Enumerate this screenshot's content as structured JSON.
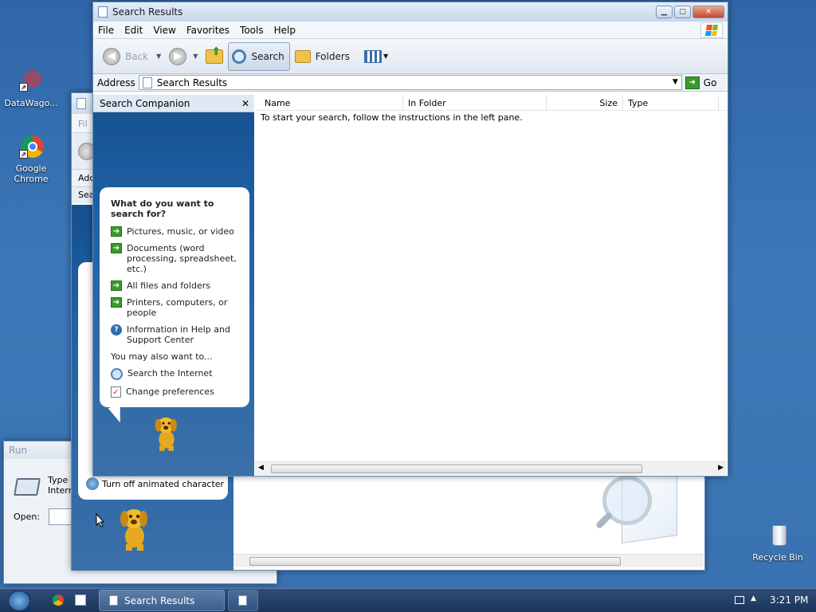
{
  "desktop": {
    "icons": [
      {
        "label": "DataWago..."
      },
      {
        "label": "Google Chrome"
      },
      {
        "label": "Recycle Bin"
      }
    ]
  },
  "run_dialog": {
    "title": "Run",
    "text": "Type\nIntern",
    "open_label": "Open:"
  },
  "back_window": {
    "menu_fragment": "Fil",
    "address_fragment": "Add",
    "search_fragment": "Sea",
    "turn_off_label": "Turn off animated character"
  },
  "main_window": {
    "title": "Search Results",
    "menu": [
      "File",
      "Edit",
      "View",
      "Favorites",
      "Tools",
      "Help"
    ],
    "toolbar": {
      "back_label": "Back",
      "search_label": "Search",
      "folders_label": "Folders"
    },
    "address": {
      "label": "Address",
      "value": "Search Results",
      "go_label": "Go"
    },
    "companion": {
      "title": "Search Companion",
      "question": "What do you want to search for?",
      "options": [
        {
          "label": "Pictures, music, or video",
          "icon": "arrow-right-icon"
        },
        {
          "label": "Documents (word processing, spreadsheet, etc.)",
          "icon": "arrow-right-icon"
        },
        {
          "label": "All files and folders",
          "icon": "arrow-right-icon"
        },
        {
          "label": "Printers, computers, or people",
          "icon": "arrow-right-icon"
        },
        {
          "label": "Information in Help and Support Center",
          "icon": "help-icon"
        }
      ],
      "also_label": "You may also want to...",
      "extra": [
        {
          "label": "Search the Internet",
          "icon": "search-internet-icon"
        },
        {
          "label": "Change preferences",
          "icon": "preferences-icon"
        }
      ]
    },
    "columns": [
      "Name",
      "In Folder",
      "Size",
      "Type"
    ],
    "empty_message": "To start your search, follow the instructions in the left pane."
  },
  "taskbar": {
    "window_label": "Search Results",
    "time": "3:21 PM"
  },
  "colors": {
    "desktop": "#3b6ea5",
    "pane": "#1f63a8",
    "accent_green": "#3a9a2b"
  }
}
